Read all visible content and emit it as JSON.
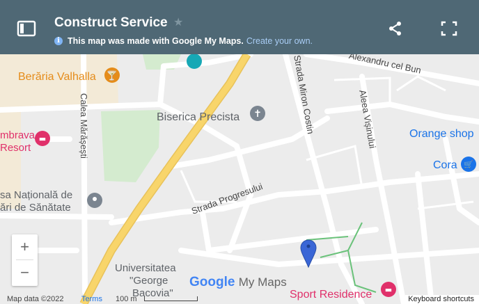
{
  "header": {
    "title": "Construct Service",
    "subtitle_text": "This map was made with Google My Maps.",
    "subtitle_link": "Create your own.",
    "info_symbol": "i"
  },
  "map": {
    "labels": {
      "beraria": "Berăria Valhalla",
      "calea_marasesti": "Calea Mărășești",
      "biserica": "Biserica Precista",
      "dumbrava_1": "mbrava",
      "dumbrava_2": "Resort",
      "casa_1": "sa Națională de",
      "casa_2": "ări de Sănătate",
      "strada_miron": "Strada Miron Costin",
      "alexandru": "Alexandru cel Bun",
      "aleea": "Aleea Vișinului",
      "orange": "Orange shop",
      "cora": "Cora",
      "progresului": "Strada Progresului",
      "univ_1": "Universitatea",
      "univ_2": "\"George",
      "univ_3": "Bacovia\"",
      "sport": "Sport Residence",
      "google": "Google",
      "mymaps": "My Maps"
    },
    "colors": {
      "header_bg": "#4f6875",
      "map_bg": "#ececec",
      "road_major": "#f8d56b",
      "pink_poi": "#e0306a",
      "orange_poi": "#e58c1a",
      "blue_poi": "#1a73e8",
      "gray_poi": "#7b8590",
      "marker": "#3a66d6"
    }
  },
  "controls": {
    "zoom_in": "+",
    "zoom_out": "−"
  },
  "footer": {
    "map_data": "Map data ©2022",
    "terms": "Terms",
    "scale": "100 m",
    "keyboard": "Keyboard shortcuts"
  }
}
